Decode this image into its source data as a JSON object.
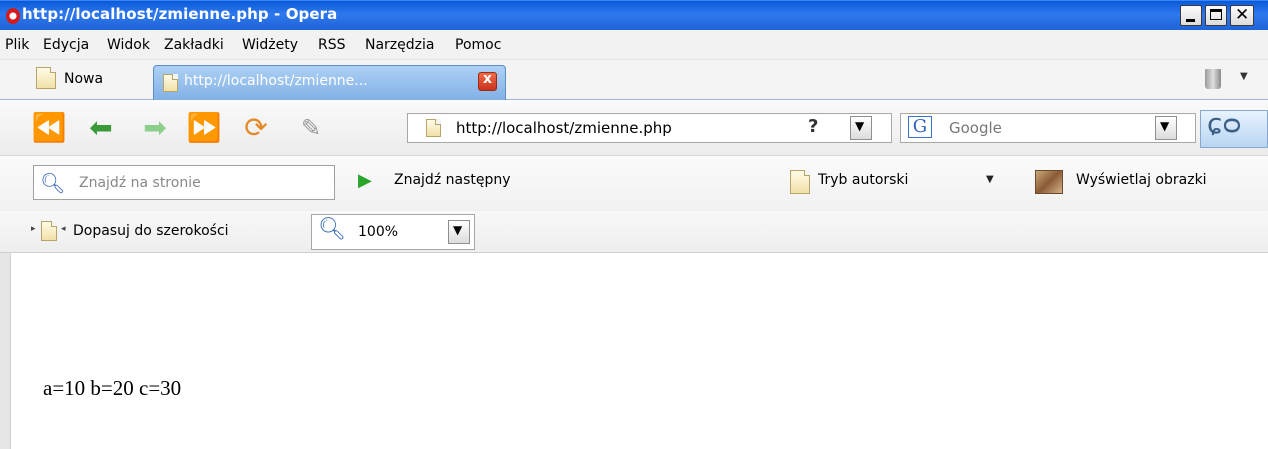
{
  "window": {
    "title": "http://localhost/zmienne.php - Opera"
  },
  "menu": [
    "Plik",
    "Edycja",
    "Widok",
    "Zakładki",
    "Widżety",
    "RSS",
    "Narzędzia",
    "Pomoc"
  ],
  "tabs": {
    "new_tab_label": "Nowa",
    "active_tab_label": "http://localhost/zmienne...",
    "close_symbol": "x"
  },
  "nav": {
    "address": "http://localhost/zmienne.php",
    "help_symbol": "?",
    "search_engine": "Google",
    "search_engine_icon": "G"
  },
  "find": {
    "placeholder": "Znajdź na stronie",
    "find_next_label": "Znajdź następny",
    "author_mode_label": "Tryb autorski",
    "show_images_label": "Wyświetlaj obrazki"
  },
  "zoom": {
    "fit_width_label": "Dopasuj do szerokości",
    "value": "100%"
  },
  "content": {
    "text": "a=10 b=20 c=30"
  },
  "icons": {
    "back_many": "fast-back-icon",
    "back": "back-icon",
    "forward": "forward-icon",
    "forward_many": "fast-forward-icon",
    "reload": "reload-icon",
    "edit": "pencil-icon",
    "glasses": "glasses-icon"
  },
  "colors": {
    "titlebar": "#1f63d6",
    "active_tab": "#7fb0e6",
    "close_red": "#c8321b"
  }
}
